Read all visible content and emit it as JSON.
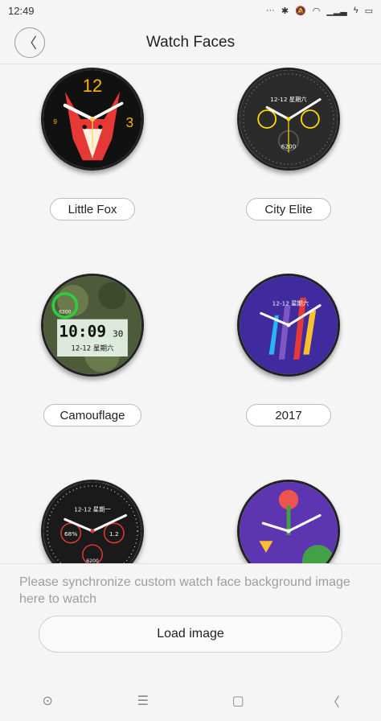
{
  "status": {
    "time": "12:49"
  },
  "header": {
    "title": "Watch Faces"
  },
  "faces": [
    {
      "label": "Little Fox"
    },
    {
      "label": "City Elite"
    },
    {
      "label": "Camouflage"
    },
    {
      "label": "2017"
    }
  ],
  "fox_face": {
    "num12": "12",
    "num3": "3",
    "num9": "9"
  },
  "city_face": {
    "date": "12-12 星期六",
    "steps": "6200"
  },
  "camo_face": {
    "steps": "6200",
    "time": "10:09",
    "seconds": "30",
    "date": "12-12 星期六"
  },
  "y2017_face": {
    "date": "12-12 星期六"
  },
  "sport_face": {
    "date": "12-12 星期一",
    "pct": "68%",
    "dist": "1.2",
    "steps": "6200"
  },
  "sync": {
    "text": "Please synchronize custom watch face background image here to watch",
    "button": "Load image"
  },
  "nav": {
    "home": "⊙",
    "menu": "☰",
    "recent": "▢",
    "back": "〈"
  }
}
